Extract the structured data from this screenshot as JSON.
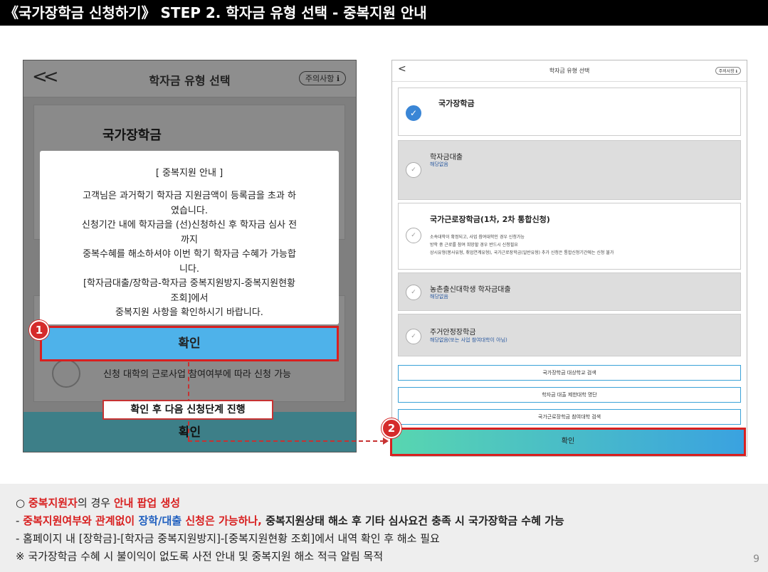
{
  "title": "《국가장학금 신청하기》 STEP 2. 학자금 유형 선택 - 중복지원 안내",
  "left_phone": {
    "back": "<<",
    "header_title": "학자금 유형 선택",
    "notice_badge": "주의사항 ℹ",
    "card_title": "국가장학금",
    "bottom_text": "신청 대학의 근로사업 참여여부에 따라 신청 가능",
    "footer_label": "확인",
    "modal": {
      "title": "[ 중복지원 안내 ]",
      "lines": [
        "고객님은 과거학기 학자금 지원금액이 등록금을 초과 하",
        "였습니다.",
        "신청기간 내에 학자금을 (선)신청하신 후 학자금 심사 전",
        "까지",
        "중복수혜를 해소하셔야 이번 학기 학자금 수혜가 가능합",
        "니다.",
        "[학자금대출/장학금-학자금 중복지원방지-중복지원현황",
        "조회]에서",
        "중복지원 사항을 확인하시기 바랍니다."
      ],
      "confirm": "확인"
    },
    "badge": "1",
    "callout": "확인 후 다음 신청단계 진행"
  },
  "right_phone": {
    "back": "<",
    "header_title": "학자금 유형 선택",
    "notice_badge": "주의사항 ℹ",
    "cards": [
      {
        "title": "국가장학금",
        "sub": "",
        "checked": "✓"
      },
      {
        "title": "학자금대출",
        "sub": "해당없음",
        "checked": "✓"
      },
      {
        "title": "국가근로장학금(1차, 2차 통합신청)",
        "sub": "",
        "checked": "✓",
        "desc": [
          "소속대학이 확정되고, 사업 참여대학인 경우 신청가능",
          "방학 중 근로를 참여 희망할 경우 반드시 신청필요",
          "상시유형(봉사유형, 취업연계유형), 국가근로장학금(일반유형) 추가 신청은 통합신청기간에는 신청 불가"
        ]
      },
      {
        "title": "농촌출신대학생 학자금대출",
        "sub": "해당없음",
        "checked": "✓"
      },
      {
        "title": "주거안정장학금",
        "sub": "해당없음(또는 사업 참여대학이 아님)",
        "checked": "✓"
      }
    ],
    "links": [
      "국가장학금 대상학교 검색",
      "학자금 대출 제한대학 명단",
      "국가근로장학금 참여대학 검색"
    ],
    "confirm": "확인",
    "badge": "2"
  },
  "notes": {
    "line1_bullet": "○ ",
    "line1_red1": "중복지원자",
    "line1_mid": "의 경우 ",
    "line1_red2": "안내 팝업 생성",
    "line2_prefix": " - ",
    "line2_red": "중복지원여부와 관계없이 ",
    "line2_blue": "장학/대출",
    "line2_red2": " 신청은 가능하나, ",
    "line2_bold": "중복지원상태 해소 후 기타 심사요건 충족 시 국가장학금 수혜 가능",
    "line3": " - 홈페이지 내 [장학금]-[학자금 중복지원방지]-[중복지원현황 조회]에서 내역 확인 후 해소 필요",
    "line4": "  ※ 국가장학금 수혜 시 불이익이 없도록 사전 안내 및 중복지원 해소 적극 알림 목적",
    "page_number": "9"
  },
  "colors": {
    "accent_red": "#d82020",
    "accent_blue": "#4eb2ea",
    "link_blue": "#1f5fbf"
  }
}
